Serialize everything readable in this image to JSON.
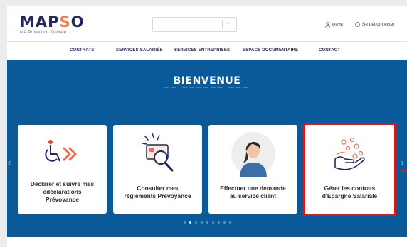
{
  "brand": {
    "name_prefix": "MAP",
    "name_accent": "S",
    "name_suffix": "O",
    "tagline_prefix": "MA Protection ",
    "tagline_accent": "SO",
    "tagline_suffix": "ciale",
    "colors": {
      "primary": "#20285d",
      "accent": "#ff7a3d"
    }
  },
  "header": {
    "search_select": {
      "value": "",
      "icon": "chevron-down-icon"
    },
    "profile_label": "Profil",
    "logout_label": "Se déconnecter"
  },
  "nav": {
    "items": [
      {
        "label": "CONTRATS"
      },
      {
        "label": "SERVICES SALARIÉS"
      },
      {
        "label": "SERVICES ENTREPRISES"
      },
      {
        "label": "ESPACE DOCUMENTAIRE"
      },
      {
        "label": "CONTACT"
      }
    ]
  },
  "hero": {
    "title": "BIENVENUE",
    "background_color": "#0a5a9a",
    "cards": [
      {
        "line1": "Déclarer et suivre mes",
        "line2": "edéclarations",
        "line3": "Prévoyance",
        "icon": "disability-arrows-icon"
      },
      {
        "line1": "Consulter mes",
        "line2": "règlements Prévoyance",
        "icon": "document-magnifier-icon"
      },
      {
        "line1": "Effectuer une demande",
        "line2": "au service client",
        "icon": "customer-service-agent-icon"
      },
      {
        "line1": "Gérer les contrats",
        "line2": "d'Epargne Salariale",
        "icon": "hand-coins-icon",
        "selected": true
      }
    ],
    "carousel": {
      "page_count": 9,
      "active_index": 1
    },
    "highlight_color": "#e0161b"
  }
}
